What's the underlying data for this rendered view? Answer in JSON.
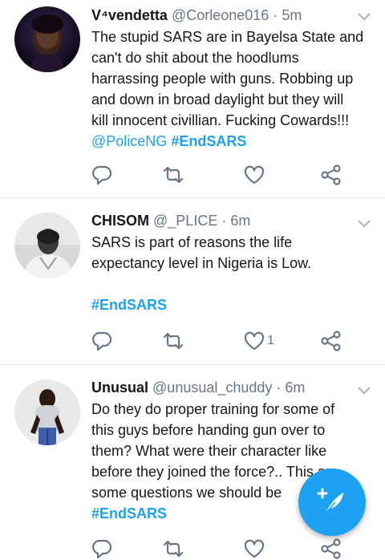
{
  "tweets": [
    {
      "display_name": "V⁴vendetta",
      "handle": "@Corleone016",
      "time": "5m",
      "line1": "The stupid SARS are in Bayelsa State and",
      "line2": "can't do shit about the hoodlums",
      "line3": "harrassing people with guns. Robbing up",
      "line4": "and down in broad daylight but they will",
      "line5": "kill innocent civillian. Fucking Cowards!!!",
      "mention": "@PoliceNG",
      "hashtag": "#EndSARS",
      "like_count": ""
    },
    {
      "display_name": "CHISOM",
      "handle": "@_PLICE",
      "time": "6m",
      "line1": "SARS is part of reasons the life",
      "line2": "expectancy level in Nigeria is Low.",
      "hashtag": "#EndSARS",
      "like_count": "1"
    },
    {
      "display_name": "Unusual",
      "handle": "@unusual_chuddy",
      "time": "6m",
      "line1": "Do they do proper training for some of",
      "line2": "this guys before handing gun over to",
      "line3": "them? What were their character like",
      "line4": "before they joined the force?.. This are",
      "line5": "some questions we should be",
      "hashtag": "#EndSARS",
      "like_count": ""
    }
  ],
  "separator": " · ",
  "icons": {
    "reply": "reply-icon",
    "retweet": "retweet-icon",
    "like": "heart-icon",
    "share": "share-icon",
    "compose": "compose-feather-icon",
    "more": "chevron-down-icon"
  },
  "colors": {
    "accent": "#1da1f2",
    "text": "#14171a",
    "muted": "#657786",
    "divider": "#e1e8ed"
  }
}
